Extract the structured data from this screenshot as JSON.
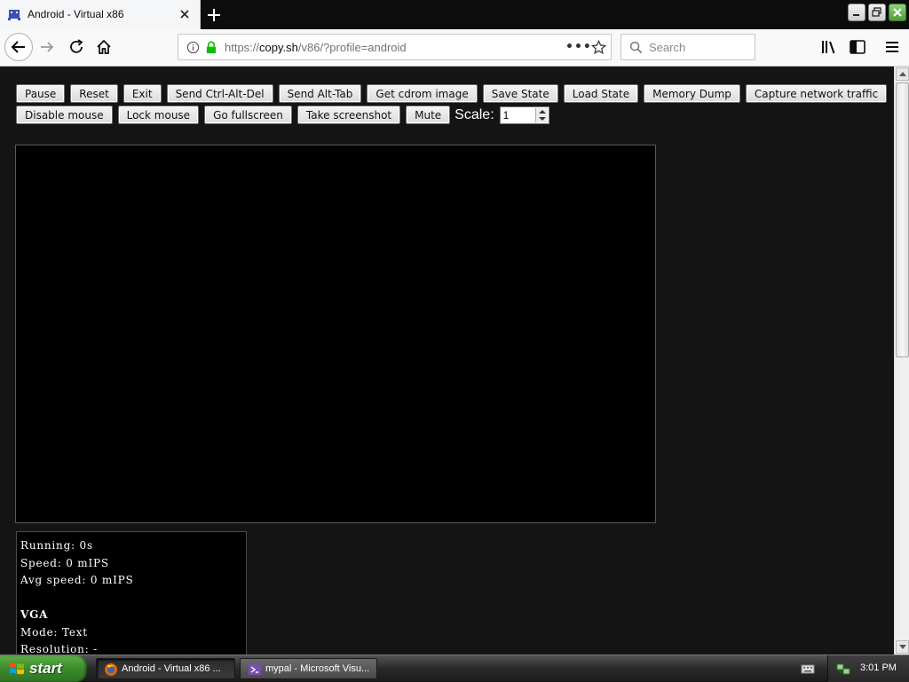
{
  "browser": {
    "tab": {
      "title": "Android - Virtual x86"
    },
    "url": {
      "prefix": "https://",
      "host": "copy.sh",
      "path": "/v86/?profile=android"
    },
    "search": {
      "placeholder": "Search"
    }
  },
  "toolbar": {
    "row1": [
      "Pause",
      "Reset",
      "Exit",
      "Send Ctrl-Alt-Del",
      "Send Alt-Tab",
      "Get cdrom image",
      "Save State",
      "Load State",
      "Memory Dump",
      "Capture network traffic"
    ],
    "row2": [
      "Disable mouse",
      "Lock mouse",
      "Go fullscreen",
      "Take screenshot",
      "Mute"
    ],
    "scale_label": "Scale:",
    "scale_value": "1"
  },
  "stats": {
    "running": "Running: 0s",
    "speed": "Speed: 0 mIPS",
    "avg_speed": "Avg speed: 0 mIPS",
    "vga_heading": "VGA",
    "mode": "Mode: Text",
    "resolution": "Resolution: -"
  },
  "taskbar": {
    "start_label": "start",
    "tasks": [
      {
        "label": "Android - Virtual x86 ..."
      },
      {
        "label": "mypal - Microsoft Visu..."
      }
    ],
    "clock": "3:01 PM"
  },
  "colors": {
    "page_background": "#141414",
    "screen_background": "#000000",
    "start_green": "#3b8a2c"
  }
}
